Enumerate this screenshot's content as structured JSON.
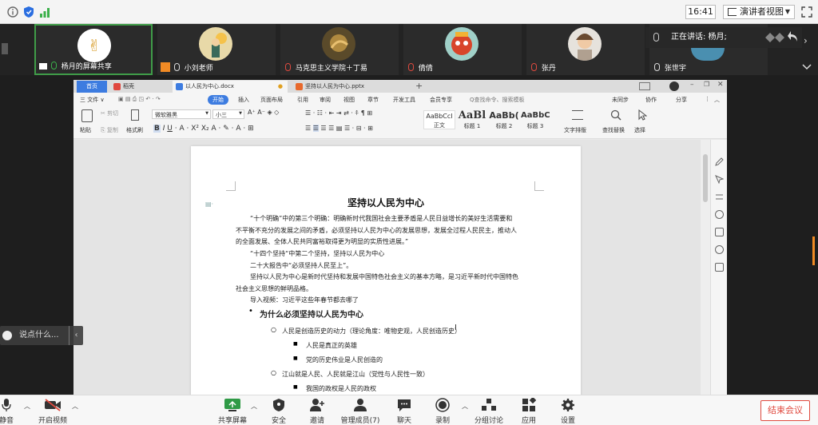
{
  "topbar": {
    "time": "16:41",
    "view_mode": "演讲者视图"
  },
  "participants": [
    {
      "name": "杨月的屏幕共享",
      "active": true
    },
    {
      "name": "小刘老师"
    },
    {
      "name": "马克思主义学院＋丁易"
    },
    {
      "name": "倩倩"
    },
    {
      "name": "张丹"
    },
    {
      "name": "张世宇"
    }
  ],
  "speaking": {
    "label": "正在讲话: 杨月;"
  },
  "wps": {
    "tabs": [
      {
        "label": "首页"
      },
      {
        "label": "稻壳"
      },
      {
        "label": "以人民为中心.docx"
      },
      {
        "label": "坚持以人民为中心.pptx"
      }
    ],
    "menu": [
      "三 文件 ∨",
      "开始",
      "插入",
      "页面布局",
      "引用",
      "审阅",
      "视图",
      "章节",
      "开发工具",
      "会员专享"
    ],
    "search_placeholder": "Q查找命令、搜索模板",
    "right_menu": [
      "未同步",
      "协作",
      "分享"
    ],
    "ribbon": {
      "paste": "粘贴",
      "cut": "剪切",
      "copy": "复制",
      "format_painter": "格式刷",
      "font_name": "微软雅黑",
      "font_size": "小三",
      "styles": [
        {
          "preview": "AaBbCcI",
          "name": "正文"
        },
        {
          "preview": "AaBl",
          "name": "标题 1"
        },
        {
          "preview": "AaBb(",
          "name": "标题 2"
        },
        {
          "preview": "AaBbC",
          "name": "标题 3"
        }
      ],
      "text_layout": "文字排版",
      "find_replace": "查找替换",
      "select": "选择"
    },
    "document": {
      "title": "坚持以人民为中心",
      "lines": [
        "“十个明确”中的第三个明确：明确新时代我国社会主要矛盾是人民日益增长的美好生活需要和",
        "不平衡不充分的发展之间的矛盾，必须坚持以人民为中心的发展思想，发展全过程人民民主，推动人",
        "的全面发展、全体人民共同富裕取得更为明显的实质性进展。”",
        "“十四个坚持“中第二个坚持，坚持以人民为中心",
        "二十大报告中“必须坚持人民至上”。",
        "坚持以人民为中心是新时代坚持和发展中国特色社会主义的基本方略，是习近平新时代中国特色",
        "社会主义思想的鲜明品格。",
        "导入视频：习近平这些年春节都去哪了"
      ],
      "heading1": "为什么必须坚持以人民为中心",
      "sub1": "人民是创造历史的动力（理论角度：唯物史观，人民创造历史）",
      "sub1_items": [
        "人民是真正的英雄",
        "党的历史伟业是人民创造的"
      ],
      "sub2": "江山就是人民、人民就是江山（党性与人民性一致）",
      "sub2_items": [
        "我国的政权是人民的政权"
      ]
    }
  },
  "chat": {
    "placeholder": "说点什么..."
  },
  "bottombar": {
    "mute": "静音",
    "video": "开启视频",
    "share": "共享屏幕",
    "security": "安全",
    "invite": "邀请",
    "manage": "管理成员(7)",
    "chat": "聊天",
    "record": "录制",
    "breakout": "分组讨论",
    "apps": "应用",
    "settings": "设置",
    "end": "结束会议"
  }
}
